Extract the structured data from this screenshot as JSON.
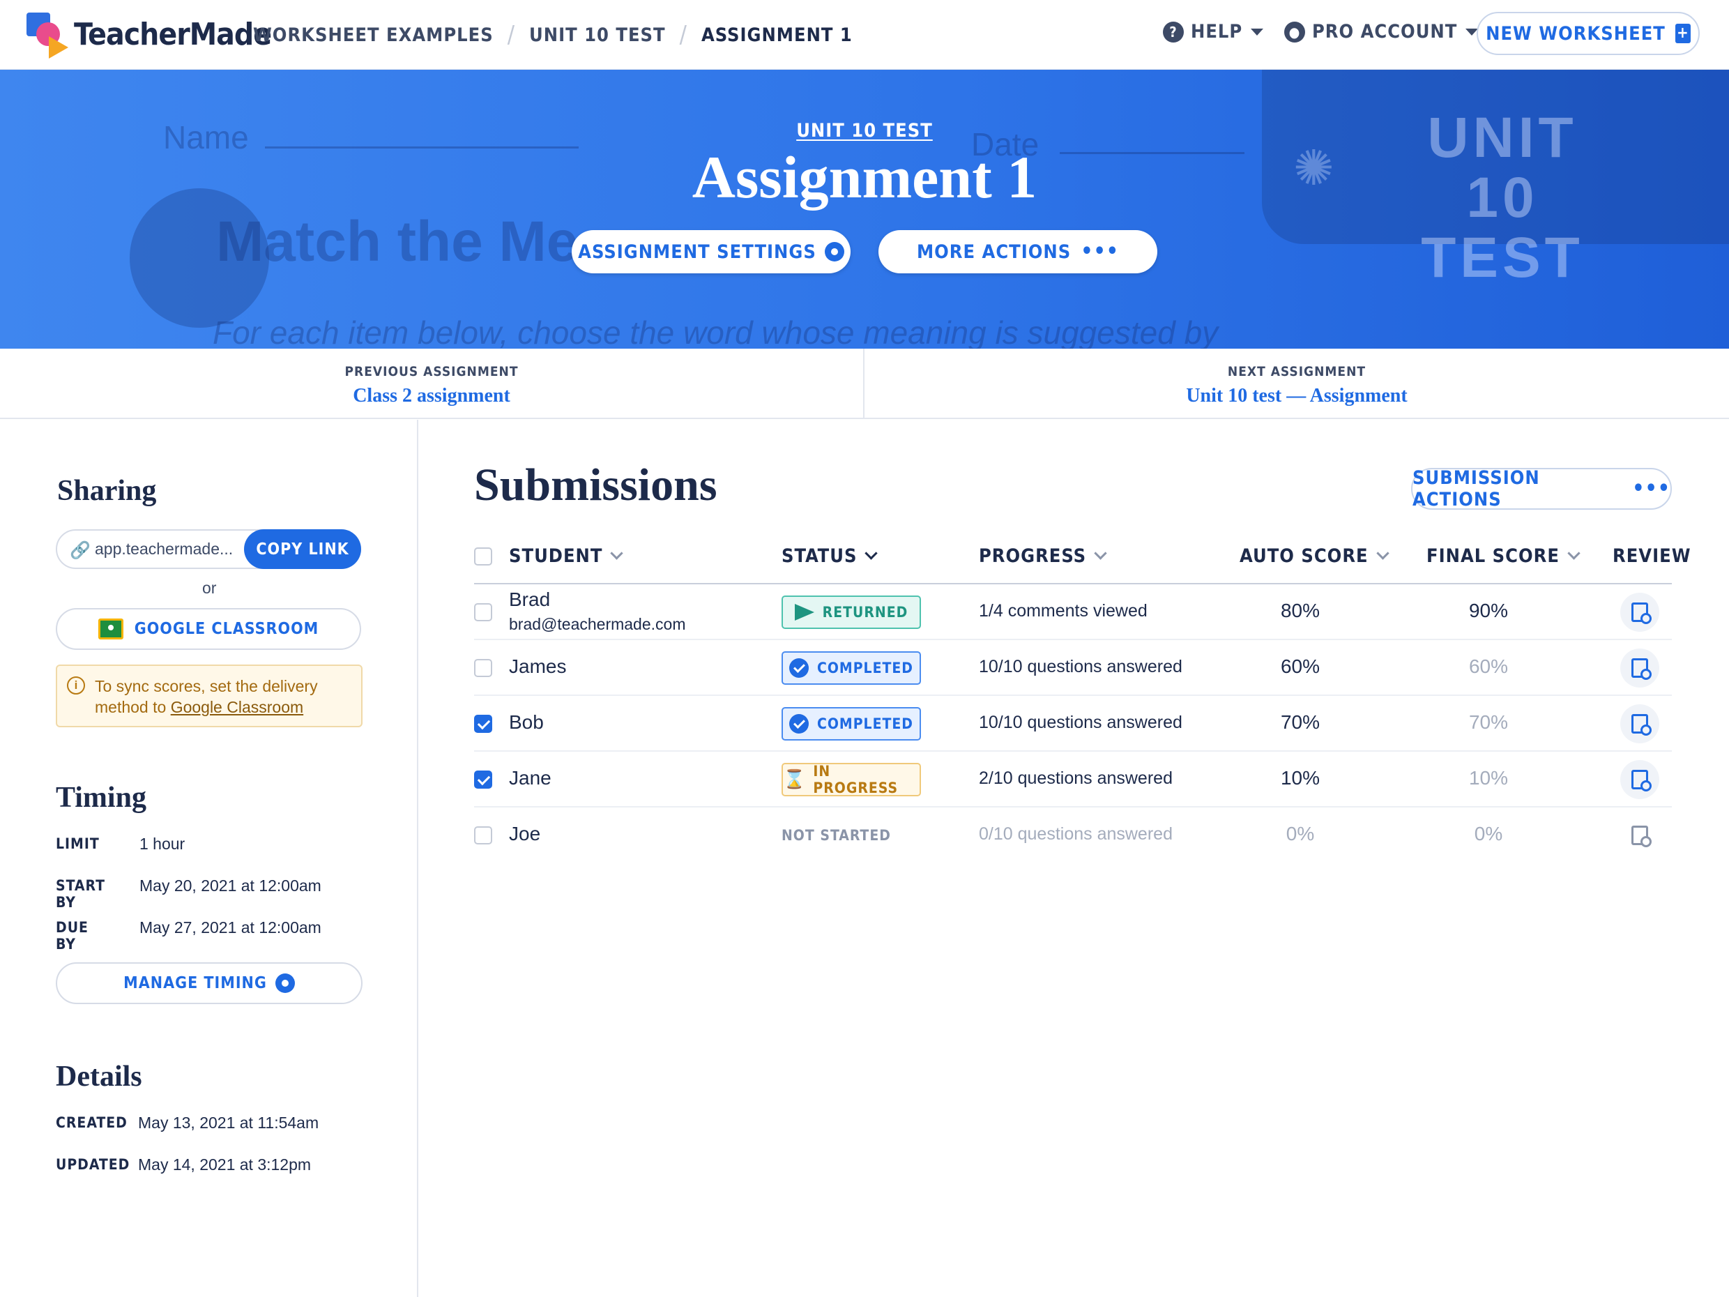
{
  "header": {
    "brand": "TeacherMade",
    "breadcrumbs": [
      "WORKSHEET EXAMPLES",
      "UNIT 10 TEST",
      "ASSIGNMENT 1"
    ],
    "help_label": "HELP",
    "account_label": "PRO ACCOUNT",
    "new_worksheet_label": "NEW WORKSHEET",
    "brand_colors": {
      "primary": "#1f6ae2",
      "hero": "#2e74e8"
    }
  },
  "hero": {
    "parent_link": "UNIT 10 TEST",
    "title": "Assignment 1",
    "settings_label": "ASSIGNMENT SETTINGS",
    "more_actions_label": "MORE ACTIONS",
    "background_text": {
      "name": "Name",
      "date": "Date",
      "match": "Match the Me",
      "instruction": "For each item below, choose the word whose meaning is suggested by",
      "stamp": "UNIT 10 TEST"
    }
  },
  "navigation": {
    "previous_label": "PREVIOUS ASSIGNMENT",
    "previous_value": "Class 2 assignment",
    "next_label": "NEXT ASSIGNMENT",
    "next_value": "Unit 10 test — Assignment"
  },
  "sharing": {
    "title": "Sharing",
    "link": "app.teachermade...",
    "copy_label": "COPY LINK",
    "or": "or",
    "google_classroom_label": "GOOGLE CLASSROOM",
    "sync_note_1": "To sync scores, set the delivery",
    "sync_note_2_prefix": "method to ",
    "sync_note_2_link": "Google Classroom"
  },
  "timing": {
    "title": "Timing",
    "rows": [
      {
        "key": "LIMIT",
        "value": "1 hour"
      },
      {
        "key": "START BY",
        "value": "May 20, 2021 at 12:00am"
      },
      {
        "key": "DUE BY",
        "value": "May 27, 2021 at 12:00am"
      }
    ],
    "manage_label": "MANAGE TIMING"
  },
  "details": {
    "title": "Details",
    "rows": [
      {
        "key": "CREATED",
        "value": "May 13, 2021 at 11:54am"
      },
      {
        "key": "UPDATED",
        "value": "May 14, 2021 at 3:12pm"
      }
    ]
  },
  "submissions": {
    "title": "Submissions",
    "actions_label": "SUBMISSION ACTIONS",
    "columns": [
      "STUDENT",
      "STATUS",
      "PROGRESS",
      "AUTO SCORE",
      "FINAL SCORE",
      "REVIEW"
    ],
    "rows": [
      {
        "name": "Brad",
        "email": "brad@teachermade.com",
        "checked": false,
        "status": "RETURNED",
        "progress": "1/4 comments viewed",
        "auto": "80%",
        "final": "90%"
      },
      {
        "name": "James",
        "checked": false,
        "status": "COMPLETED",
        "progress": "10/10 questions answered",
        "auto": "60%",
        "final": "60%"
      },
      {
        "name": "Bob",
        "checked": true,
        "status": "COMPLETED",
        "progress": "10/10 questions answered",
        "auto": "70%",
        "final": "70%"
      },
      {
        "name": "Jane",
        "checked": true,
        "status": "IN PROGRESS",
        "progress": "2/10 questions answered",
        "auto": "10%",
        "final": "10%"
      },
      {
        "name": "Joe",
        "checked": false,
        "status": "NOT STARTED",
        "progress": "0/10 questions answered",
        "auto": "0%",
        "final": "0%"
      }
    ]
  }
}
